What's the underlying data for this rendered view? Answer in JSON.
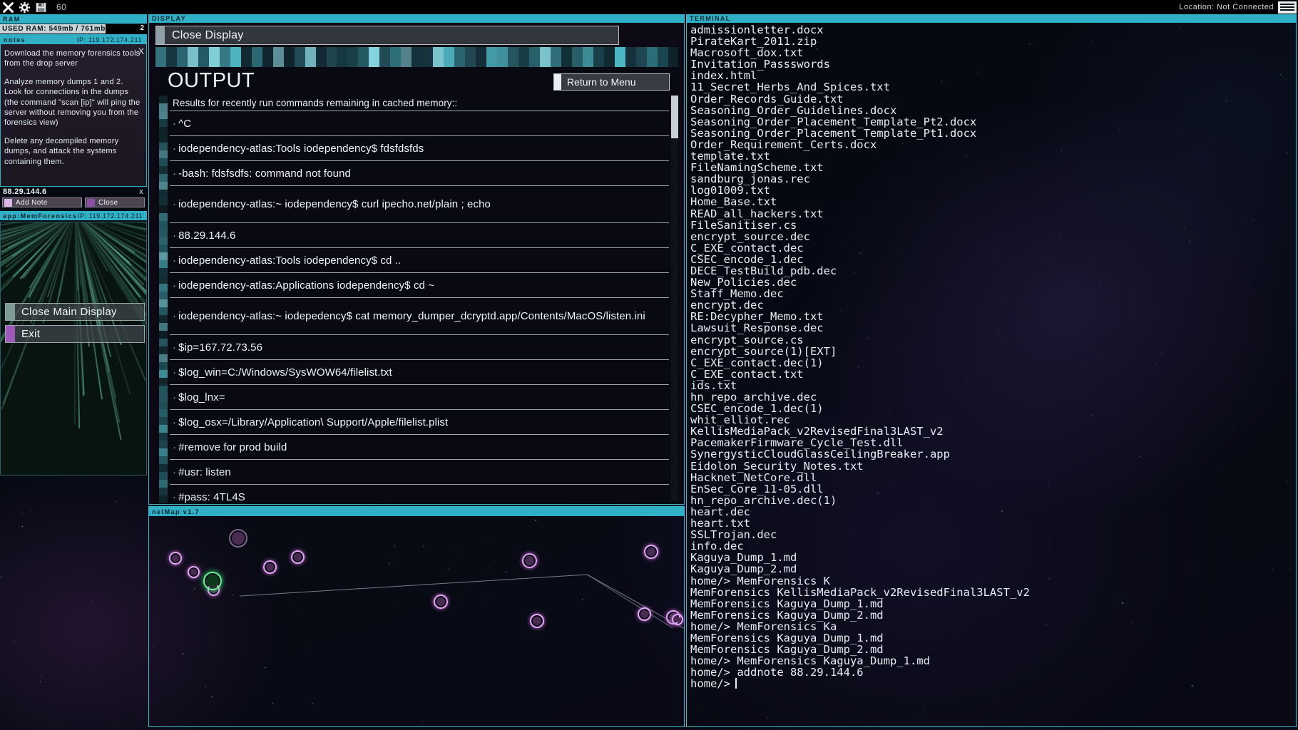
{
  "topbar": {
    "fps": "60",
    "location_label": "Location: Not Connected",
    "icons": [
      "close-icon",
      "gear-icon",
      "save-icon",
      "menu-icon"
    ]
  },
  "ram": {
    "header": "RAM",
    "usage_text": "USED RAM: 549mb / 761mb",
    "used_mb": 549,
    "total_mb": 761,
    "process_count": "2"
  },
  "notes": {
    "header": "notes",
    "ip_label": "IP: 119.172.174.211",
    "close_icon": "X",
    "paragraphs": [
      "Download the memory forensics tools from the drop server",
      "Analyze memory dumps 1 and 2. Look for connections in the dumps (the command \"scan [ip]\" will ping the server without removing you from the forensics view)",
      "Delete any decompiled memory dumps, and attack the systems containing them."
    ]
  },
  "note_entry": {
    "ip": "88.29.144.6",
    "close_x": "x",
    "add_note_label": "Add Note",
    "close_label": "Close"
  },
  "memforensics": {
    "header": "app:MemForensics",
    "ip_label": "IP: 119.172.174.211"
  },
  "main_buttons": {
    "close_main_display": "Close Main Display",
    "exit": "Exit"
  },
  "display": {
    "header": "DISPLAY",
    "close_display_label": "Close Display",
    "output_title": "OUTPUT",
    "return_to_menu_label": "Return to Menu",
    "subheader": "Results for recently run commands remaining in cached memory::",
    "rows": [
      "^C",
      "iodependency-atlas:Tools iodependency$ fdsfdsfds",
      "-bash: fdsfsdfs: command not found",
      "iodependency-atlas:~ iodependency$ curl ipecho.net/plain ; echo",
      "88.29.144.6",
      "iodependency-atlas:Tools iodependency$ cd ..",
      "iodependency-atlas:Applications iodependency$ cd ~",
      "iodependency-atlas:~ iodepedency$ cat memory_dumper_dcryptd.app/Contents/MacOS/listen.ini",
      "$ip=167.72.73.56",
      "$log_win=C:/Windows/SysWOW64/filelist.txt",
      "$log_lnx=",
      "$log_osx=/Library/Application\\ Support/Apple/filelist.plist",
      "#remove for prod build",
      "#usr: listen",
      "#pass: 4TL4S"
    ]
  },
  "netmap": {
    "header": "netMap v1.7"
  },
  "terminal": {
    "header": "TERMINAL",
    "lines": [
      "admissionletter.docx",
      "PirateKart_2011.zip",
      "Macrosoft_dox.txt",
      "Invitation_Passswords",
      "index.html",
      "11_Secret_Herbs_And_Spices.txt",
      "Order_Records_Guide.txt",
      "Seasoning_Order_Guidelines.docx",
      "Seasoning_Order_Placement_Template_Pt2.docx",
      "Seasoning_Order_Placement_Template_Pt1.docx",
      "Order_Requirement_Certs.docx",
      "template.txt",
      "FileNamingScheme.txt",
      "sandburg_jonas.rec",
      "log01009.txt",
      "Home_Base.txt",
      "READ_all_hackers.txt",
      "FileSanitiser.cs",
      "encrypt_source.dec",
      "C_EXE_contact.dec",
      "CSEC_encode_1.dec",
      "DECE_TestBuild_pdb.dec",
      "New_Policies.dec",
      "Staff_Memo.dec",
      "encrypt.dec",
      "RE:Decypher_Memo.txt",
      "Lawsuit_Response.dec",
      "encrypt_source.cs",
      "encrypt_source(1)[EXT]",
      "C_EXE_contact.dec(1)",
      "C_EXE_contact.txt",
      "ids.txt",
      "hn_repo_archive.dec",
      "CSEC_encode_1.dec(1)",
      "whit_elliot.rec",
      "KellisMediaPack_v2RevisedFinal3LAST_v2",
      "PacemakerFirmware_Cycle_Test.dll",
      "SynergysticCloudGlassCeilingBreaker.app",
      "Eidolon_Security_Notes.txt",
      "Hacknet_NetCore.dll",
      "EnSec_Core_11-05.dll",
      "hn_repo_archive.dec(1)",
      "heart.dec",
      "heart.txt",
      "SSLTrojan.dec",
      "info.dec",
      "Kaguya_Dump_1.md",
      "Kaguya_Dump_2.md",
      "home/> MemForensics K",
      "MemForensics KellisMediaPack_v2RevisedFinal3LAST_v2",
      "MemForensics Kaguya_Dump_1.md",
      "MemForensics Kaguya_Dump_2.md",
      "home/> MemForensics Ka",
      "MemForensics Kaguya_Dump_1.md",
      "MemForensics Kaguya_Dump_2.md",
      "home/> MemForensics Kaguya_Dump_1.md",
      "home/> addnote 88.29.144.6"
    ],
    "prompt": "home/>"
  },
  "colors": {
    "accent": "#2fb0c6",
    "panel_border": "#3fb7c9",
    "node_pink": "#e6a8f5",
    "node_green": "#69f58d"
  }
}
